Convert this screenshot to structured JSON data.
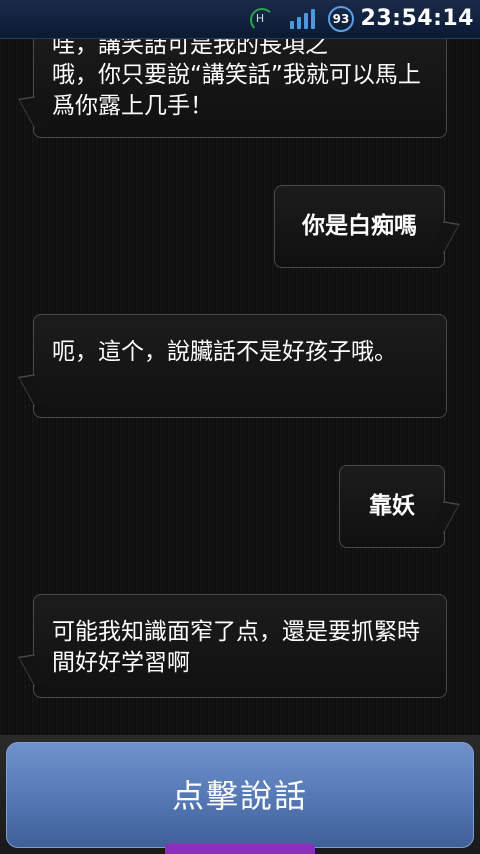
{
  "status_bar": {
    "network_label": "H",
    "battery_level": "93",
    "time": "23:54:14"
  },
  "messages": [
    {
      "sender": "bot",
      "text_partial": "哇，講笑話可是我的長項之",
      "text": "哦，你只要說“講笑話”我就可以馬上爲你露上几手！"
    },
    {
      "sender": "user",
      "text": "你是白痴嗎"
    },
    {
      "sender": "bot",
      "text": "呃，這个，說臟話不是好孩子哦。"
    },
    {
      "sender": "user",
      "text": "靠妖"
    },
    {
      "sender": "bot",
      "text": "可能我知識面窄了点，還是要抓緊時間好好学習啊"
    }
  ],
  "speak_button": {
    "label": "点擊說話"
  },
  "colors": {
    "button_blue": "#5a7fc0",
    "accent_purple": "#8a2fbf",
    "status_blue": "#0b1a33"
  }
}
